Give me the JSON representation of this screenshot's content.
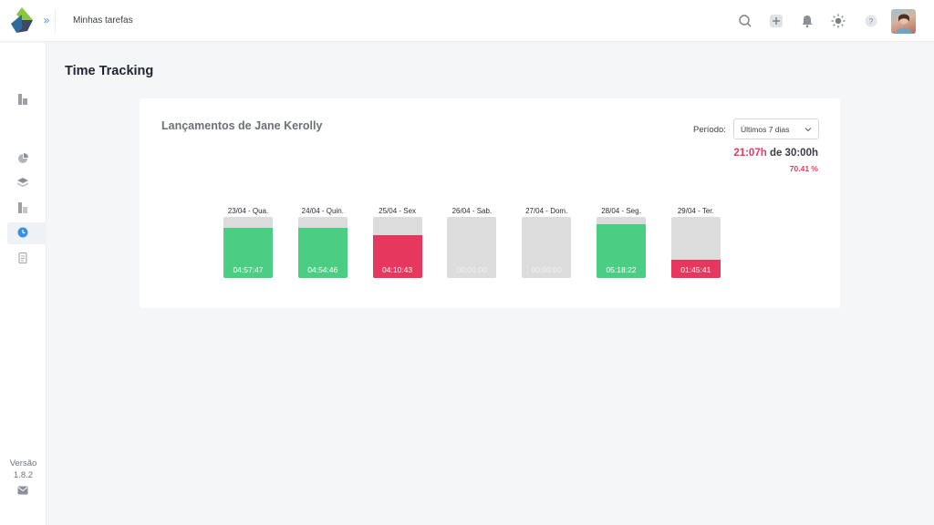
{
  "header": {
    "title": "Minhas tarefas",
    "icons": [
      "search-icon",
      "add-icon",
      "bell-icon",
      "theme-sun-icon",
      "help-icon"
    ]
  },
  "sidebar": {
    "icons": [
      "dashboard-icon",
      "reports-pie-icon",
      "layers-icon",
      "projects-icon",
      "time-tracking-icon",
      "documents-icon"
    ],
    "version_label": "Versão",
    "version_number": "1.8.2",
    "mail_icon": "mail-icon"
  },
  "page": {
    "title": "Time Tracking"
  },
  "card": {
    "title": "Lançamentos de Jane Kerolly",
    "period_label": "Período:",
    "period_value": "Últimos 7 dias",
    "worked": "21:07h",
    "of_text": " de 30:00h",
    "percent": "70.41 %"
  },
  "colors": {
    "accent": "#3b8fe0",
    "ok": "#4ccd84",
    "low": "#e6385e",
    "track": "#dcdcdc"
  },
  "chart_data": {
    "type": "bar",
    "categories": [
      "23/04 - Qua.",
      "24/04 - Quin.",
      "25/04 - Sex",
      "26/04 - Sab.",
      "27/04 - Dom.",
      "28/04 - Seg.",
      "29/04 - Ter."
    ],
    "labels": [
      "04:57:47",
      "04:54:46",
      "04:10:43",
      "00:00:00",
      "00:00:00",
      "05:18:22",
      "01:45:41"
    ],
    "values": [
      4.963,
      4.913,
      4.179,
      0,
      0,
      5.306,
      1.761
    ],
    "status": [
      "ok",
      "ok",
      "low",
      "empty",
      "empty",
      "ok",
      "low"
    ],
    "ylim": [
      0,
      6
    ]
  }
}
